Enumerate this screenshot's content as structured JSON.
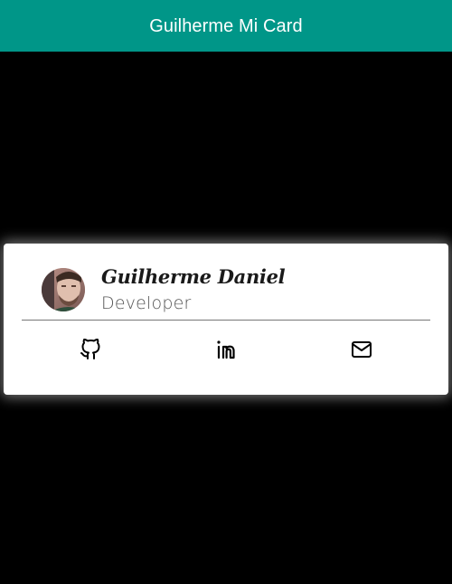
{
  "app_bar": {
    "title": "Guilherme Mi Card",
    "color": "#009688"
  },
  "card": {
    "name": "Guilherme Daniel",
    "role": "Developer",
    "avatar_alt": "profile photo",
    "links": [
      {
        "icon": "github-icon",
        "label": "GitHub"
      },
      {
        "icon": "linkedin-icon",
        "label": "LinkedIn"
      },
      {
        "icon": "email-icon",
        "label": "Email"
      }
    ]
  }
}
